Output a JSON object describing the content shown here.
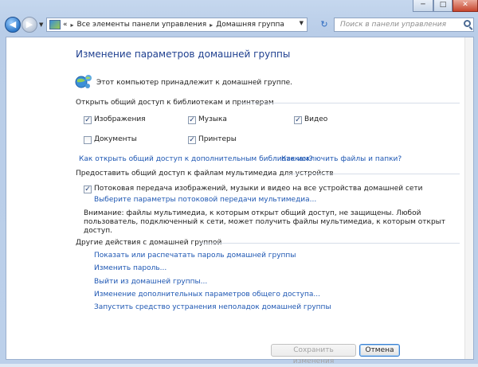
{
  "window": {
    "minimize": "─",
    "maximize": "□",
    "close": "✕"
  },
  "nav": {
    "back": "◀",
    "forward": "▶",
    "address": {
      "root_chevron": "«",
      "crumbs": [
        "Все элементы панели управления",
        "Домашняя группа"
      ],
      "separator": "▸"
    },
    "refresh": "↻",
    "search_placeholder": "Поиск в панели управления"
  },
  "page": {
    "title": "Изменение параметров домашней группы",
    "membership_text": "Этот компьютер принадлежит к домашней группе.",
    "libraries_heading": "Открыть общий доступ к библиотекам и принтерам",
    "libraries": [
      {
        "label": "Изображения",
        "checked": true
      },
      {
        "label": "Музыка",
        "checked": true
      },
      {
        "label": "Видео",
        "checked": true
      },
      {
        "label": "Документы",
        "checked": false
      },
      {
        "label": "Принтеры",
        "checked": true
      }
    ],
    "link_more_libraries": "Как открыть общий доступ к дополнительным библиотекам?",
    "link_exclude": "Как исключить файлы и папки?",
    "media_heading": "Предоставить общий доступ к файлам мультимедиа для устройств",
    "media_stream_label": "Потоковая передача изображений, музыки и видео на все устройства домашней сети",
    "media_stream_checked": true,
    "media_options_link": "Выберите параметры потоковой передачи мультимедиа...",
    "warning_line1": "Внимание: файлы мультимедиа, к которым открыт общий доступ, не защищены. Любой",
    "warning_line2": "пользователь, подключенный к сети, может получить файлы мультимедиа, к которым открыт",
    "warning_line3": "доступ.",
    "other_heading": "Другие действия с домашней группой",
    "other_links": [
      "Показать или распечатать пароль домашней группы",
      "Изменить пароль...",
      "Выйти из домашней группы...",
      "Изменение дополнительных параметров общего доступа...",
      "Запустить средство устранения неполадок домашней группы"
    ],
    "save_button": "Сохранить изменения",
    "cancel_button": "Отмена"
  }
}
